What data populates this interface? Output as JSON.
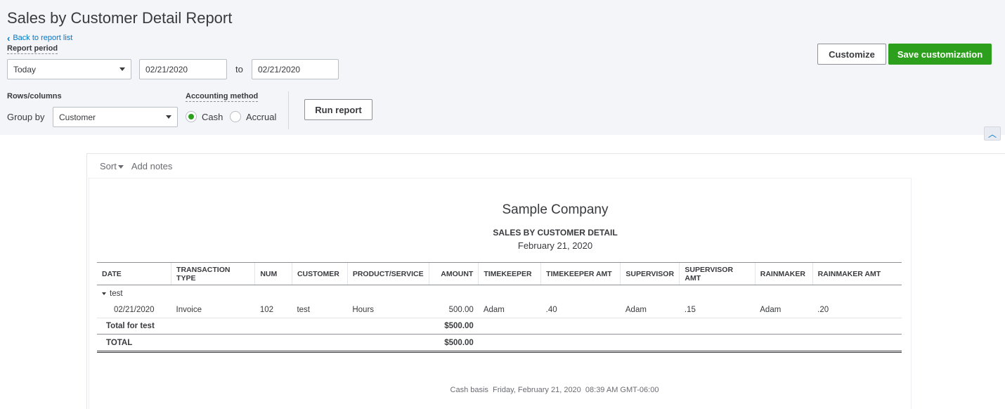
{
  "header": {
    "title": "Sales by Customer Detail Report",
    "back_link": "Back to report list"
  },
  "filters": {
    "report_period_label": "Report period",
    "period_value": "Today",
    "date_from": "02/21/2020",
    "to_label": "to",
    "date_to": "02/21/2020",
    "rows_columns_label": "Rows/columns",
    "group_by_label": "Group by",
    "group_by_value": "Customer",
    "accounting_method_label": "Accounting method",
    "cash_label": "Cash",
    "accrual_label": "Accrual",
    "selected_method": "Cash",
    "run_report_label": "Run report"
  },
  "actions": {
    "customize_label": "Customize",
    "save_customization_label": "Save customization"
  },
  "toolbar": {
    "sort_label": "Sort",
    "add_notes_label": "Add notes"
  },
  "report": {
    "company": "Sample Company",
    "title": "SALES BY CUSTOMER DETAIL",
    "date": "February 21, 2020",
    "columns": [
      "DATE",
      "TRANSACTION TYPE",
      "NUM",
      "CUSTOMER",
      "PRODUCT/SERVICE",
      "AMOUNT",
      "TIMEKEEPER",
      "TIMEKEEPER AMT",
      "SUPERVISOR",
      "SUPERVISOR AMT",
      "RAINMAKER",
      "RAINMAKER AMT"
    ],
    "group_name": "test",
    "rows": [
      [
        "02/21/2020",
        "Invoice",
        "102",
        "test",
        "Hours",
        "500.00",
        "Adam",
        ".40",
        "Adam",
        ".15",
        "Adam",
        ".20"
      ]
    ],
    "subtotal_label": "Total for test",
    "subtotal_amount": "$500.00",
    "total_label": "TOTAL",
    "total_amount": "$500.00",
    "footer": "Cash basis  Friday, February 21, 2020  08:39 AM GMT-06:00"
  },
  "colors": {
    "primary_green": "#2ca01c",
    "link_blue": "#0077c5",
    "header_bg": "#f4f5f8"
  },
  "icons": {
    "back": "chevron-left-icon",
    "collapse": "chevron-up-icon",
    "group_toggle": "caret-down-icon"
  }
}
